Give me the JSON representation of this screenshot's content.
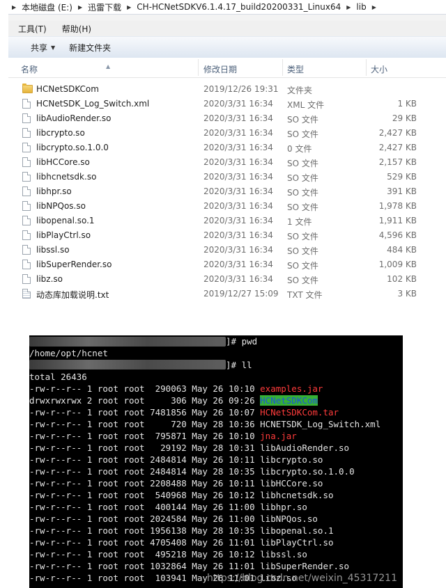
{
  "explorer": {
    "breadcrumb": [
      "本地磁盘 (E:)",
      "迅雷下载",
      "CH-HCNetSDKV6.1.4.17_build20200331_Linux64",
      "lib"
    ],
    "menu": [
      "工具(T)",
      "帮助(H)"
    ],
    "toolbar": {
      "share": "共享",
      "new_folder": "新建文件夹"
    },
    "columns": {
      "name": "名称",
      "date": "修改日期",
      "type": "类型",
      "size": "大小"
    },
    "files": [
      {
        "name": "HCNetSDKCom",
        "date": "2019/12/26 19:31",
        "type": "文件夹",
        "size": "",
        "icon": "folder-icon"
      },
      {
        "name": "HCNetSDK_Log_Switch.xml",
        "date": "2020/3/31 16:34",
        "type": "XML 文件",
        "size": "1 KB",
        "icon": "file-icon"
      },
      {
        "name": "libAudioRender.so",
        "date": "2020/3/31 16:34",
        "type": "SO 文件",
        "size": "29 KB",
        "icon": "file-icon"
      },
      {
        "name": "libcrypto.so",
        "date": "2020/3/31 16:34",
        "type": "SO 文件",
        "size": "2,427 KB",
        "icon": "file-icon"
      },
      {
        "name": "libcrypto.so.1.0.0",
        "date": "2020/3/31 16:34",
        "type": "0 文件",
        "size": "2,427 KB",
        "icon": "file-icon"
      },
      {
        "name": "libHCCore.so",
        "date": "2020/3/31 16:34",
        "type": "SO 文件",
        "size": "2,157 KB",
        "icon": "file-icon"
      },
      {
        "name": "libhcnetsdk.so",
        "date": "2020/3/31 16:34",
        "type": "SO 文件",
        "size": "529 KB",
        "icon": "file-icon"
      },
      {
        "name": "libhpr.so",
        "date": "2020/3/31 16:34",
        "type": "SO 文件",
        "size": "391 KB",
        "icon": "file-icon"
      },
      {
        "name": "libNPQos.so",
        "date": "2020/3/31 16:34",
        "type": "SO 文件",
        "size": "1,978 KB",
        "icon": "file-icon"
      },
      {
        "name": "libopenal.so.1",
        "date": "2020/3/31 16:34",
        "type": "1 文件",
        "size": "1,911 KB",
        "icon": "file-icon"
      },
      {
        "name": "libPlayCtrl.so",
        "date": "2020/3/31 16:34",
        "type": "SO 文件",
        "size": "4,596 KB",
        "icon": "file-icon"
      },
      {
        "name": "libssl.so",
        "date": "2020/3/31 16:34",
        "type": "SO 文件",
        "size": "484 KB",
        "icon": "file-icon"
      },
      {
        "name": "libSuperRender.so",
        "date": "2020/3/31 16:34",
        "type": "SO 文件",
        "size": "1,009 KB",
        "icon": "file-icon"
      },
      {
        "name": "libz.so",
        "date": "2020/3/31 16:34",
        "type": "SO 文件",
        "size": "102 KB",
        "icon": "file-icon"
      },
      {
        "name": "动态库加载说明.txt",
        "date": "2019/12/27 15:09",
        "type": "TXT 文件",
        "size": "3 KB",
        "icon": "text-file-icon"
      }
    ]
  },
  "terminal": {
    "cmd1": "]# pwd",
    "pwd": "/home/opt/hcnet",
    "cmd2": "]# ll",
    "total": "total 26436",
    "entries": [
      {
        "prefix": "-rw-r--r-- 1 root root  290063 May 26 10:10 ",
        "name": "examples.jar",
        "style": "red"
      },
      {
        "prefix": "drwxrwxrwx 2 root root     306 May 26 09:26 ",
        "name": "HCNetSDKCom",
        "style": "dir"
      },
      {
        "prefix": "-rw-r--r-- 1 root root 7481856 May 26 10:07 ",
        "name": "HCNetSDKCom.tar",
        "style": "red"
      },
      {
        "prefix": "-rw-r--r-- 1 root root     720 May 28 10:36 ",
        "name": "HCNETSDK_Log_Switch.xml",
        "style": "plain"
      },
      {
        "prefix": "-rw-r--r-- 1 root root  795871 May 26 10:10 ",
        "name": "jna.jar",
        "style": "red"
      },
      {
        "prefix": "-rw-r--r-- 1 root root   29192 May 28 10:31 ",
        "name": "libAudioRender.so",
        "style": "plain"
      },
      {
        "prefix": "-rw-r--r-- 1 root root 2484814 May 26 10:11 ",
        "name": "libcrypto.so",
        "style": "plain"
      },
      {
        "prefix": "-rw-r--r-- 1 root root 2484814 May 28 10:35 ",
        "name": "libcrypto.so.1.0.0",
        "style": "plain"
      },
      {
        "prefix": "-rw-r--r-- 1 root root 2208488 May 26 10:11 ",
        "name": "libHCCore.so",
        "style": "plain"
      },
      {
        "prefix": "-rw-r--r-- 1 root root  540968 May 26 10:12 ",
        "name": "libhcnetsdk.so",
        "style": "plain"
      },
      {
        "prefix": "-rw-r--r-- 1 root root  400144 May 26 11:00 ",
        "name": "libhpr.so",
        "style": "plain"
      },
      {
        "prefix": "-rw-r--r-- 1 root root 2024584 May 26 11:00 ",
        "name": "libNPQos.so",
        "style": "plain"
      },
      {
        "prefix": "-rw-r--r-- 1 root root 1956138 May 28 10:35 ",
        "name": "libopenal.so.1",
        "style": "plain"
      },
      {
        "prefix": "-rw-r--r-- 1 root root 4705408 May 26 11:01 ",
        "name": "libPlayCtrl.so",
        "style": "plain"
      },
      {
        "prefix": "-rw-r--r-- 1 root root  495218 May 26 10:12 ",
        "name": "libssl.so",
        "style": "plain"
      },
      {
        "prefix": "-rw-r--r-- 1 root root 1032864 May 26 11:01 ",
        "name": "libSuperRender.so",
        "style": "plain"
      },
      {
        "prefix": "-rw-r--r-- 1 root root  103941 May 26 11:01 ",
        "name": "libz.so",
        "style": "plain"
      }
    ],
    "watermark": "https://blog.csdn.net/weixin_45317211"
  },
  "colors": {
    "red": "#ff3b3b",
    "dir_bg": "#36b036",
    "dir_fg": "#1d54d6",
    "terminal_bg": "#000000"
  }
}
